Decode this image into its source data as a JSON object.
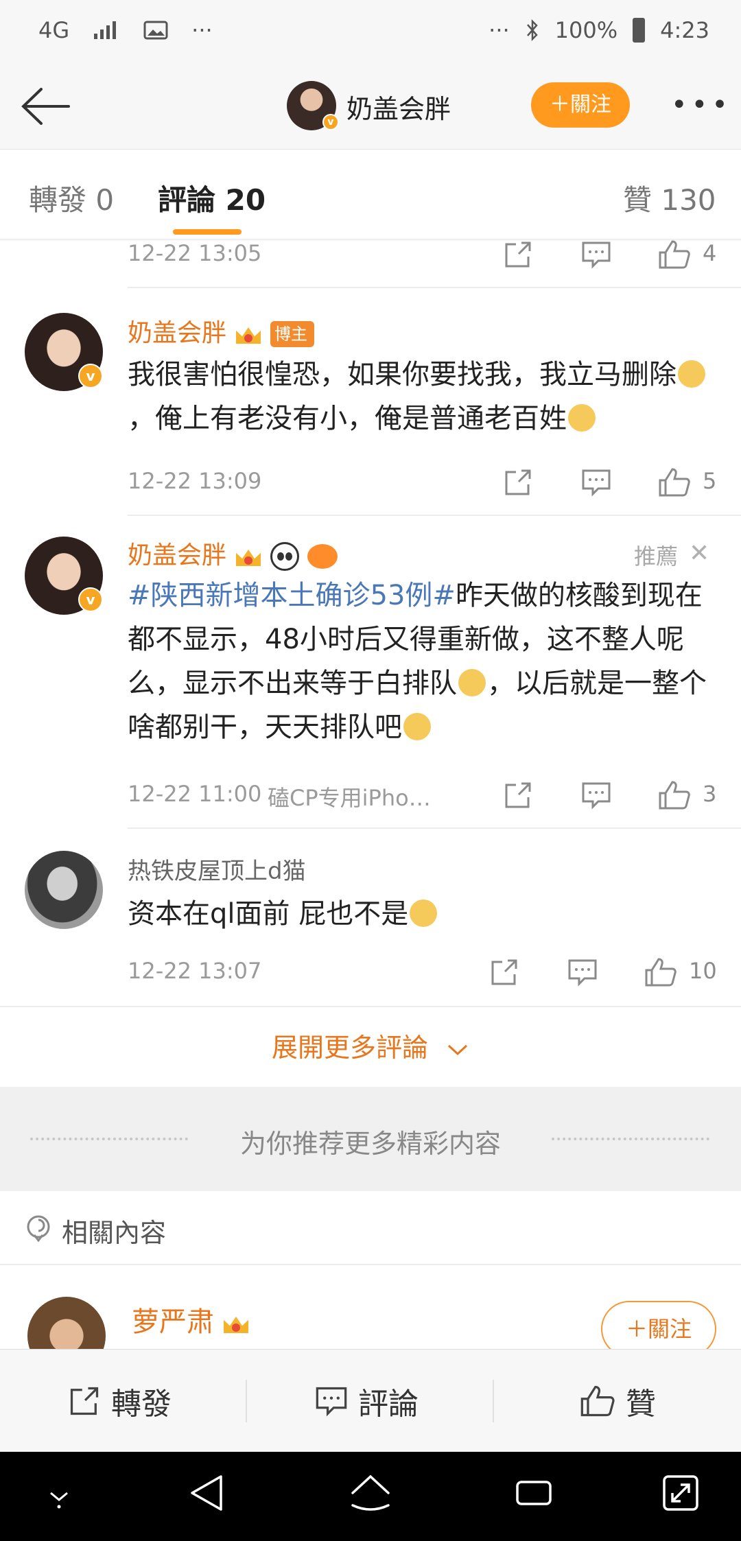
{
  "status_bar": {
    "network": "4G",
    "signal_icon": "signal-icon",
    "gallery_icon": "image-icon",
    "more": "···",
    "right_more": "···",
    "bluetooth_icon": "bluetooth-icon",
    "battery": "100%",
    "time": "4:23"
  },
  "header": {
    "title": "奶盖会胖",
    "follow_label": "＋關注",
    "more": "•••"
  },
  "tabs": {
    "repost": "轉發 0",
    "comments": "評論 20",
    "likes": "贊 130"
  },
  "top_meta": {
    "time": "12-22 13:05",
    "likes": "4"
  },
  "comments": [
    {
      "author": "奶盖会胖",
      "badge": "博主",
      "text_a": "我很害怕很惶恐，如果你要找我，我立马删除",
      "text_b": "，俺上有老没有小，俺是普通老百姓",
      "time": "12-22 13:09",
      "likes": "5"
    },
    {
      "author": "奶盖会胖",
      "recommend": "推薦",
      "topic": "#陕西新增本土确诊53例#",
      "text_a": "昨天做的核酸到现在都不显示，48小时后又得重新做，这不整人呢么，显示不出来等于白排队",
      "text_b": "，以后就是一整个啥都别干，天天排队吧",
      "time": "12-22 11:00",
      "source": "磕CP专用iPho…",
      "likes": "3"
    },
    {
      "author": "热铁皮屋顶上d猫",
      "text_a": "资本在ql面前 屁也不是",
      "time": "12-22 13:07",
      "likes": "10"
    }
  ],
  "expand_label": "展開更多評論",
  "recommend_band": "为你推荐更多精彩内容",
  "related": {
    "label": "相關內容",
    "author": "萝严肃",
    "follow_label": "＋關注"
  },
  "action_bar": {
    "repost": "轉發",
    "comment": "評論",
    "like": "贊"
  },
  "colors": {
    "accent": "#ff9a1f",
    "name_orange": "#e8761c",
    "topic_blue": "#4a77b8"
  }
}
